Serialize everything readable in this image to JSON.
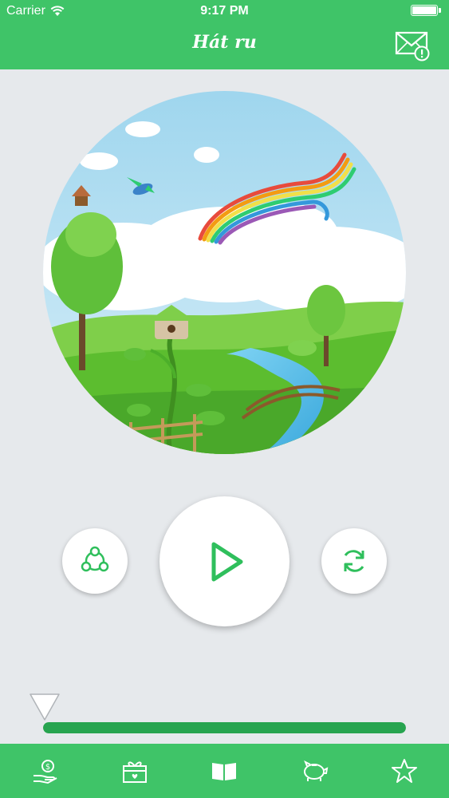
{
  "status_bar": {
    "carrier": "Carrier",
    "time": "9:17 PM"
  },
  "header": {
    "title": "Hát ru"
  },
  "icons": {
    "mail": "mail-alert-icon",
    "share": "share-icon",
    "play": "play-icon",
    "repeat": "repeat-icon",
    "tabs": [
      "donate-hand-icon",
      "gift-box-icon",
      "book-icon",
      "piggy-bank-icon",
      "star-icon"
    ]
  },
  "player": {
    "progress": 0.0
  },
  "colors": {
    "brand": "#3fc468",
    "accent": "#27a44f",
    "background": "#e6e9ec"
  }
}
